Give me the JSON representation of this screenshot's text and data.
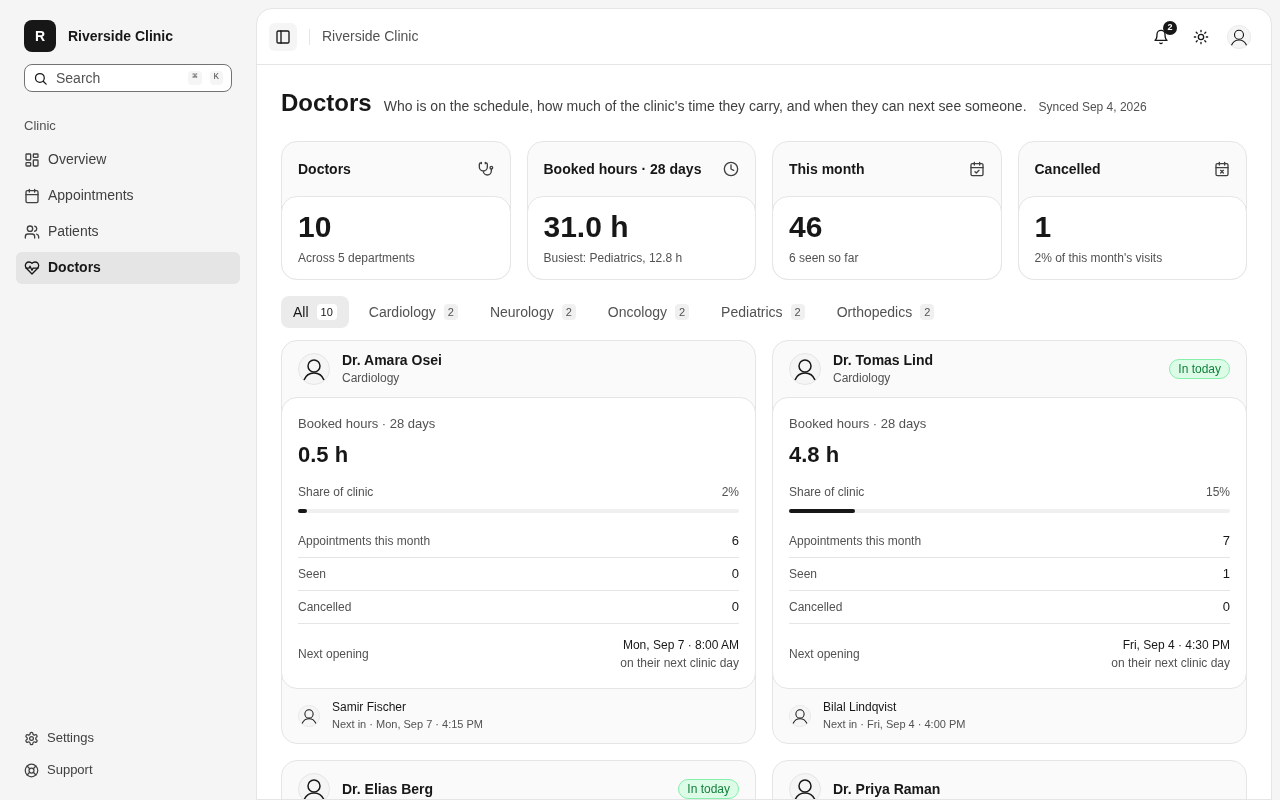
{
  "sidebar": {
    "brand": {
      "initial": "R",
      "name": "Riverside Clinic"
    },
    "search": {
      "placeholder": "Search",
      "keys": [
        "⌘",
        "K"
      ]
    },
    "section": "Clinic",
    "items": [
      {
        "label": "Overview",
        "selected": false
      },
      {
        "label": "Appointments",
        "selected": false
      },
      {
        "label": "Patients",
        "selected": false
      },
      {
        "label": "Doctors",
        "selected": true
      }
    ],
    "footer": [
      {
        "label": "Settings"
      },
      {
        "label": "Support"
      }
    ]
  },
  "topbar": {
    "breadcrumb": "Riverside Clinic",
    "notifications": "2"
  },
  "page": {
    "title": "Doctors",
    "subtitle": "Who is on the schedule, how much of the clinic's time they carry, and when they can next see someone.",
    "synced": "Synced Sep 4, 2026"
  },
  "stats": [
    {
      "title": "Doctors",
      "value": "10",
      "note": "Across 5 departments"
    },
    {
      "title": "Booked hours · 28 days",
      "value": "31.0 h",
      "note": "Busiest: Pediatrics, 12.8 h"
    },
    {
      "title": "This month",
      "value": "46",
      "note": "6 seen so far"
    },
    {
      "title": "Cancelled",
      "value": "1",
      "note": "2% of this month's visits"
    }
  ],
  "filters": [
    {
      "label": "All",
      "count": "10",
      "selected": true
    },
    {
      "label": "Cardiology",
      "count": "2",
      "selected": false
    },
    {
      "label": "Neurology",
      "count": "2",
      "selected": false
    },
    {
      "label": "Oncology",
      "count": "2",
      "selected": false
    },
    {
      "label": "Pediatrics",
      "count": "2",
      "selected": false
    },
    {
      "label": "Orthopedics",
      "count": "2",
      "selected": false
    }
  ],
  "doctors": [
    {
      "name": "Dr. Amara Osei",
      "department": "Cardiology",
      "in_today": false,
      "hours_label": "Booked hours · 28 days",
      "hours": "0.5 h",
      "share_label": "Share of clinic",
      "share": "2%",
      "level": 0.02,
      "rows": [
        {
          "label": "Appointments this month",
          "value": "6"
        },
        {
          "label": "Seen",
          "value": "0"
        },
        {
          "label": "Cancelled",
          "value": "0"
        }
      ],
      "next_label": "Next opening",
      "next_time": "Mon, Sep 7 · 8:00 AM",
      "next_note": "on their next clinic day",
      "patient": "Samir Fischer",
      "patient_next": "Next in · Mon, Sep 7 · 4:15 PM"
    },
    {
      "name": "Dr. Tomas Lind",
      "department": "Cardiology",
      "in_today": true,
      "badge": "In today",
      "hours_label": "Booked hours · 28 days",
      "hours": "4.8 h",
      "share_label": "Share of clinic",
      "share": "15%",
      "level": 0.15,
      "rows": [
        {
          "label": "Appointments this month",
          "value": "7"
        },
        {
          "label": "Seen",
          "value": "1"
        },
        {
          "label": "Cancelled",
          "value": "0"
        }
      ],
      "next_label": "Next opening",
      "next_time": "Fri, Sep 4 · 4:30 PM",
      "next_note": "on their next clinic day",
      "patient": "Bilal Lindqvist",
      "patient_next": "Next in · Fri, Sep 4 · 4:00 PM"
    },
    {
      "name": "Dr. Elias Berg",
      "in_today": true,
      "badge": "In today"
    },
    {
      "name": "Dr. Priya Raman",
      "in_today": false
    }
  ]
}
